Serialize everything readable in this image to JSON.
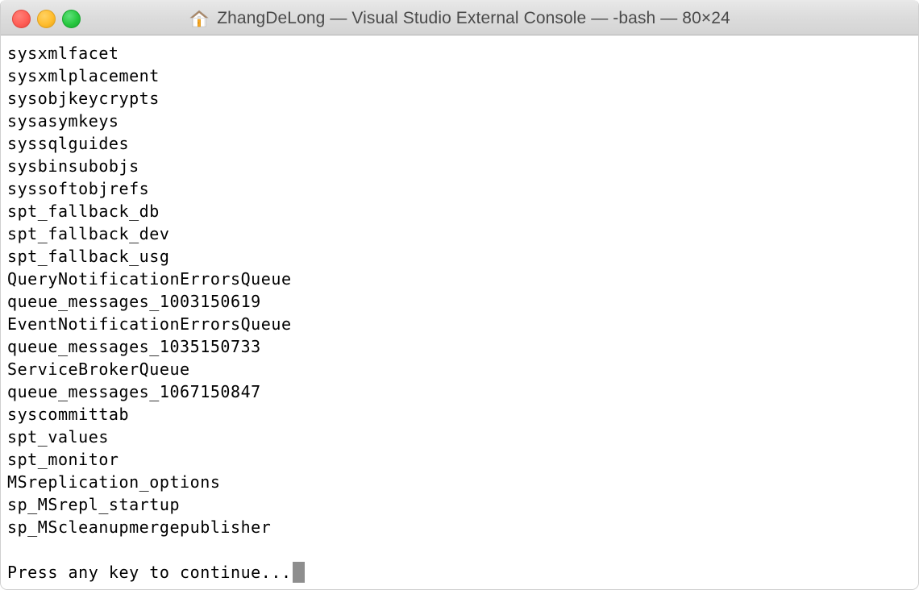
{
  "window": {
    "title": "ZhangDeLong — Visual Studio External Console — -bash — 80×24",
    "home_icon": "home-icon",
    "controls": {
      "close": "close",
      "minimize": "minimize",
      "zoom": "zoom"
    },
    "colors": {
      "close": "#ff5f57",
      "minimize": "#ffbd2e",
      "zoom": "#28c840",
      "titlebar": "#dcdcdc",
      "terminal_background": "#ffffff",
      "terminal_text": "#000000",
      "cursor": "#8e8e8e"
    }
  },
  "terminal": {
    "lines": [
      "sysxmlfacet",
      "sysxmlplacement",
      "sysobjkeycrypts",
      "sysasymkeys",
      "syssqlguides",
      "sysbinsubobjs",
      "syssoftobjrefs",
      "spt_fallback_db",
      "spt_fallback_dev",
      "spt_fallback_usg",
      "QueryNotificationErrorsQueue",
      "queue_messages_1003150619",
      "EventNotificationErrorsQueue",
      "queue_messages_1035150733",
      "ServiceBrokerQueue",
      "queue_messages_1067150847",
      "syscommittab",
      "spt_values",
      "spt_monitor",
      "MSreplication_options",
      "sp_MSrepl_startup",
      "sp_MScleanupmergepublisher",
      ""
    ],
    "prompt": "Press any key to continue...",
    "cursor": "block-cursor"
  }
}
